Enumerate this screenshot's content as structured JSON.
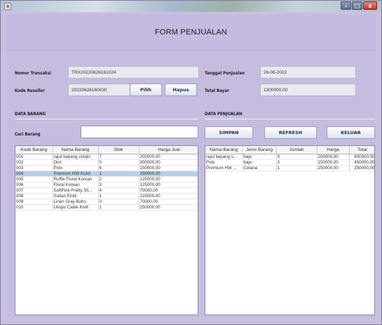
{
  "window": {
    "controls": {
      "minimize": "–",
      "maximize": "□",
      "close": "x"
    }
  },
  "header": {
    "title": "FORM PENJUALAN"
  },
  "form": {
    "nomor_transaksi": {
      "label": "Nomor Transaksi",
      "value": "TRX20220626161024"
    },
    "kode_reseller": {
      "label": "Kode Reseller",
      "value": "20220626160030"
    },
    "pilih_label": "Pilih",
    "hapus_label": "Hapus",
    "tanggal_penjualan": {
      "label": "Tanggal Penjualan",
      "value": "26-06-2022"
    },
    "total_bayar": {
      "label": "Total Bayar",
      "value": "1300000,00"
    }
  },
  "data_barang": {
    "title": "DATA BARANG",
    "search_label": "Cari Barang",
    "search_value": "",
    "columns": [
      "Kode Barang",
      "Nama Barang",
      "Stok",
      "Harga Jual"
    ],
    "rows": [
      [
        "001",
        "rajut kepang uniqlo",
        "7",
        "200000,00"
      ],
      [
        "002",
        "Dior",
        "0",
        "300000,00"
      ],
      [
        "003",
        "Polo",
        "6",
        "150000,00"
      ],
      [
        "004",
        "Premium HW Kulot",
        "1",
        "250000,00"
      ],
      [
        "005",
        "Ruffle Floral Korean",
        "2",
        "125000,00"
      ],
      [
        "006",
        "Floral Korean",
        "3",
        "125000,00"
      ],
      [
        "007",
        "SoftPink Pretty Sli...",
        "4",
        "70000,00"
      ],
      [
        "008",
        "Sultan Etnik",
        "1",
        "125000,00"
      ],
      [
        "009",
        "Linen Gray Boho",
        "0",
        "70000,00"
      ],
      [
        "010",
        "Uniqlo Cable Knitt",
        "1",
        "250000,00"
      ]
    ],
    "selected_index": 3
  },
  "data_penjualan": {
    "title": "DATA PENJUALAN",
    "simpan_label": "SIMPAN",
    "refresh_label": "REFRESH",
    "keluar_label": "KELUAR",
    "columns": [
      "Nama Barang",
      "Jenis Barang",
      "Jumlah",
      "Harga",
      "Total"
    ],
    "rows": [
      [
        "rajut kepang u...",
        "baju",
        "3",
        "200000,00",
        "600000,00"
      ],
      [
        "Polo",
        "baju",
        "3",
        "150000,00",
        "450000,00"
      ],
      [
        "Premium HW ...",
        "Celana",
        "1",
        "250000,00",
        "250000,00"
      ]
    ]
  }
}
